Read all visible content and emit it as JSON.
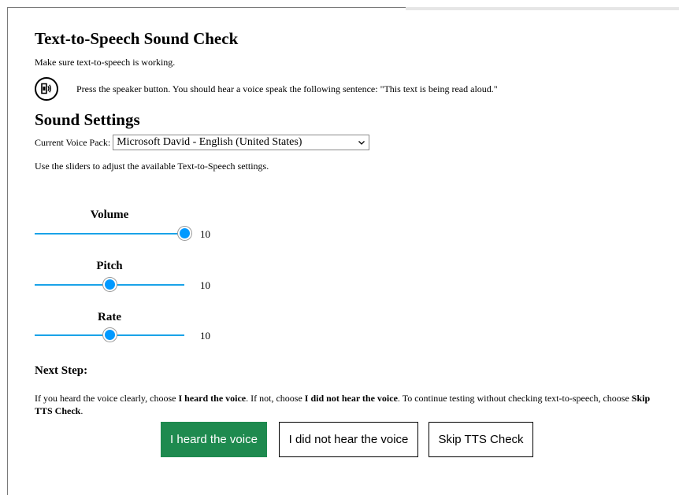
{
  "header": {
    "title": "Text-to-Speech Sound Check",
    "subtitle": "Make sure text-to-speech is working."
  },
  "speaker": {
    "icon": "speaker-icon",
    "instruction": "Press the speaker button. You should hear a voice speak the following sentence: \"This text is being read aloud.\""
  },
  "settings": {
    "heading": "Sound Settings",
    "voice_label": "Current Voice Pack:",
    "voice_value": "Microsoft David - English (United States)",
    "sliders_hint": "Use the sliders to adjust the available Text-to-Speech settings."
  },
  "sliders": [
    {
      "label": "Volume",
      "value": "10",
      "fraction": 1.0
    },
    {
      "label": "Pitch",
      "value": "10",
      "fraction": 0.5
    },
    {
      "label": "Rate",
      "value": "10",
      "fraction": 0.5
    }
  ],
  "next": {
    "heading": "Next Step:",
    "text_1": "If you heard the voice clearly, choose ",
    "bold_1": "I heard the voice",
    "text_2": ". If not, choose ",
    "bold_2": "I did not hear the voice",
    "text_3": ". To continue testing without checking text-to-speech, choose ",
    "bold_3": "Skip TTS Check",
    "text_4": "."
  },
  "buttons": {
    "heard": "I heard the voice",
    "not_heard": "I did not hear the voice",
    "skip": "Skip TTS Check"
  },
  "colors": {
    "primary_button": "#1e8a4f",
    "slider_track": "#1aa3e8",
    "slider_thumb": "#0099ff"
  }
}
